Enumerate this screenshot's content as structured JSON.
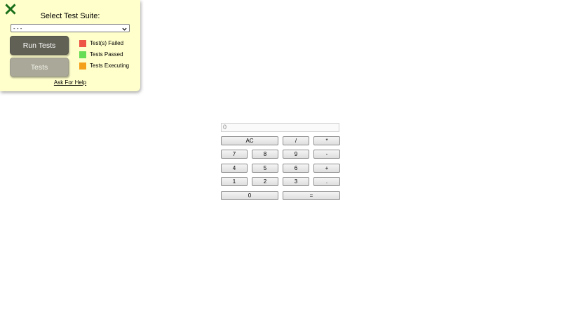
{
  "test_panel": {
    "title": "Select Test Suite:",
    "select_value": "- - -",
    "run_button": "Run Tests",
    "tests_button": "Tests",
    "legend": {
      "failed": {
        "label": "Test(s) Failed",
        "color": "#ee5544"
      },
      "passed": {
        "label": "Tests Passed",
        "color": "#66dd55"
      },
      "executing": {
        "label": "Tests Executing",
        "color": "#f5a01a"
      }
    },
    "help_link": "Ask For Help",
    "close_icon": "close-icon",
    "close_color": "#1a6e1a"
  },
  "calculator": {
    "display_placeholder": "0",
    "keys": {
      "ac": "AC",
      "divide": "/",
      "multiply": "*",
      "seven": "7",
      "eight": "8",
      "nine": "9",
      "minus": "-",
      "four": "4",
      "five": "5",
      "six": "6",
      "plus": "+",
      "one": "1",
      "two": "2",
      "three": "3",
      "decimal": ".",
      "zero": "0",
      "equals": "="
    }
  }
}
